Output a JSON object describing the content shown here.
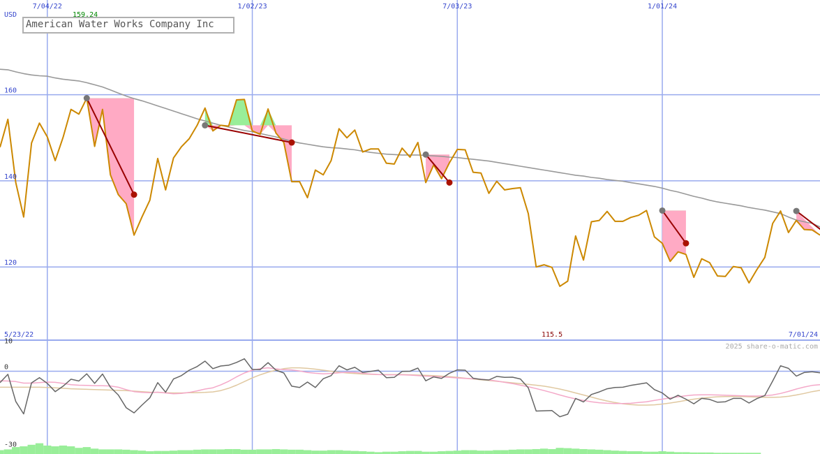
{
  "chart_data": {
    "type": "line",
    "title": "American Water Works Company Inc",
    "currency": "USD",
    "watermark": "2025 share-o-matic.com",
    "start_date_label": "5/23/22",
    "end_date_label": "7/01/24",
    "period_high_label": "159.24",
    "period_low_label": "115.5",
    "x_tick_labels": [
      "7/04/22",
      "1/02/23",
      "7/03/23",
      "1/01/24"
    ],
    "x_tick_weeks": [
      6,
      32,
      58,
      84
    ],
    "y_ticks": [
      120,
      140,
      160
    ],
    "ylim": [
      103,
      182
    ],
    "osc_ticks": [
      10,
      0,
      -30
    ],
    "osc_ylim": [
      -32,
      12
    ],
    "colors": {
      "price": "#cc8800",
      "ma": "#999999",
      "grid": "#99aaee",
      "axis_label": "#3344cc",
      "high_label": "#008800",
      "low_label": "#880000",
      "gain_fill": "#99ee99",
      "loss_fill": "#ffaac4",
      "trend_line": "#990000",
      "osc_line": "#666666",
      "osc_fast": "#f4a8c8",
      "osc_slow": "#e0c8a0",
      "volume": "#99ee99"
    },
    "series": [
      {
        "name": "price",
        "values": [
          147.8,
          154.3,
          139.6,
          131.6,
          148.8,
          153.4,
          150.2,
          144.7,
          150.1,
          156.6,
          155.5,
          159.2,
          148.0,
          156.6,
          141.4,
          136.8,
          134.7,
          127.4,
          131.6,
          135.5,
          145.2,
          137.9,
          145.3,
          147.9,
          149.8,
          152.9,
          156.9,
          151.6,
          152.9,
          152.7,
          158.8,
          158.9,
          151.6,
          150.8,
          156.7,
          151.1,
          148.9,
          139.8,
          139.8,
          136.1,
          142.5,
          141.4,
          144.7,
          152.1,
          150.0,
          151.8,
          146.7,
          147.4,
          147.4,
          144.1,
          143.9,
          147.6,
          145.5,
          148.9,
          139.6,
          143.7,
          140.5,
          144.2,
          147.3,
          147.2,
          142.0,
          141.8,
          137.1,
          139.9,
          137.9,
          138.2,
          138.4,
          132.4,
          120.0,
          120.5,
          119.9,
          115.5,
          116.7,
          127.2,
          121.6,
          130.5,
          130.8,
          132.9,
          130.6,
          130.6,
          131.5,
          132.0,
          133.1,
          127.0,
          125.5,
          121.3,
          123.5,
          122.9,
          117.6,
          121.9,
          121.0,
          117.9,
          117.8,
          120.1,
          119.8,
          116.3,
          119.4,
          122.2,
          130.1,
          133.0,
          128.0,
          130.8,
          128.7,
          128.6,
          127.4
        ],
        "x_start": 0
      },
      {
        "name": "ma",
        "values": [
          165.9,
          165.8,
          165.3,
          164.9,
          164.6,
          164.4,
          164.3,
          163.9,
          163.6,
          163.4,
          163.2,
          162.8,
          162.3,
          161.8,
          161.1,
          160.4,
          159.7,
          159.1,
          158.6,
          158.0,
          157.4,
          156.8,
          156.2,
          155.6,
          155.0,
          154.4,
          153.9,
          153.4,
          152.9,
          152.5,
          152.1,
          151.7,
          151.4,
          151.0,
          150.6,
          150.2,
          149.7,
          149.2,
          148.8,
          148.5,
          148.2,
          147.9,
          147.7,
          147.6,
          147.4,
          147.2,
          146.9,
          146.6,
          146.4,
          146.2,
          146.1,
          146.0,
          146.0,
          146.0,
          145.9,
          145.8,
          145.7,
          145.5,
          145.4,
          145.2,
          145.0,
          144.8,
          144.6,
          144.3,
          144.0,
          143.7,
          143.4,
          143.1,
          142.8,
          142.5,
          142.2,
          141.9,
          141.6,
          141.3,
          141.1,
          140.8,
          140.6,
          140.3,
          140.1,
          139.9,
          139.6,
          139.3,
          139.0,
          138.7,
          138.3,
          137.8,
          137.4,
          136.9,
          136.4,
          136.0,
          135.5,
          135.1,
          134.8,
          134.5,
          134.2,
          133.8,
          133.5,
          133.2,
          132.8,
          132.4,
          131.6,
          130.9,
          130.5,
          130.1,
          129.3
        ],
        "x_start": 0
      },
      {
        "name": "oscillator",
        "values": [
          -4.4,
          -1.2,
          -11.7,
          -16.5,
          -4.5,
          -2.5,
          -4.7,
          -7.9,
          -5.8,
          -3.1,
          -3.8,
          -1.0,
          -4.7,
          -1.1,
          -6.2,
          -9.2,
          -14.1,
          -16.1,
          -13.1,
          -10.3,
          -4.4,
          -8.1,
          -3.0,
          -1.7,
          0.4,
          1.8,
          3.9,
          1.0,
          2.0,
          2.3,
          3.4,
          4.8,
          0.7,
          0.6,
          3.3,
          0.4,
          -0.7,
          -5.8,
          -6.3,
          -4.2,
          -6.3,
          -2.9,
          -1.7,
          2.1,
          0.5,
          1.5,
          -0.5,
          -0.1,
          0.4,
          -2.5,
          -2.4,
          -0.1,
          0.0,
          1.2,
          -3.7,
          -2.2,
          -2.8,
          -0.8,
          0.5,
          0.4,
          -2.7,
          -3.2,
          -3.4,
          -2.0,
          -2.4,
          -2.3,
          -3.0,
          -6.4,
          -15.4,
          -15.3,
          -15.2,
          -17.6,
          -16.6,
          -10.5,
          -11.9,
          -9.0,
          -8.0,
          -6.8,
          -6.3,
          -6.2,
          -5.5,
          -5.0,
          -4.5,
          -7.1,
          -8.4,
          -10.8,
          -9.3,
          -10.8,
          -12.6,
          -10.5,
          -10.9,
          -12.0,
          -11.8,
          -10.5,
          -10.5,
          -12.3,
          -10.6,
          -9.4,
          -3.8,
          2.1,
          1.1,
          -1.9,
          -0.5,
          -0.2,
          -0.6
        ],
        "x_start": 0
      },
      {
        "name": "oscillator_fast",
        "values": [
          -3.7,
          -3.8,
          -4.0,
          -4.6,
          -4.6,
          -4.4,
          -4.2,
          -4.3,
          -4.7,
          -5.2,
          -5.4,
          -5.5,
          -5.6,
          -5.6,
          -5.7,
          -6.2,
          -7.1,
          -7.9,
          -8.2,
          -8.3,
          -8.1,
          -8.4,
          -8.7,
          -8.6,
          -8.2,
          -7.6,
          -6.9,
          -6.4,
          -5.3,
          -3.9,
          -2.2,
          -0.7,
          0.4,
          1.0,
          1.3,
          0.9,
          0.6,
          0.5,
          0.1,
          -0.5,
          -0.8,
          -1.0,
          -0.9,
          -0.6,
          -0.4,
          -0.5,
          -0.8,
          -1.1,
          -1.3,
          -1.4,
          -1.4,
          -1.4,
          -1.5,
          -1.7,
          -1.9,
          -2.0,
          -2.2,
          -2.4,
          -2.6,
          -2.8,
          -2.9,
          -3.1,
          -3.4,
          -3.8,
          -4.3,
          -4.8,
          -5.4,
          -6.0,
          -6.7,
          -7.5,
          -8.3,
          -9.2,
          -10.0,
          -10.7,
          -11.3,
          -11.8,
          -12.2,
          -12.4,
          -12.5,
          -12.5,
          -12.4,
          -12.1,
          -11.8,
          -11.3,
          -10.8,
          -10.3,
          -9.9,
          -9.5,
          -9.2,
          -9.1,
          -9.1,
          -9.2,
          -9.3,
          -9.4,
          -9.5,
          -9.6,
          -9.6,
          -9.5,
          -9.2,
          -8.6,
          -7.8,
          -6.9,
          -6.1,
          -5.5,
          -5.2
        ],
        "x_start": 0
      },
      {
        "name": "oscillator_slow",
        "values": [
          -6.2,
          -6.2,
          -6.2,
          -6.2,
          -6.2,
          -6.2,
          -6.3,
          -6.4,
          -6.6,
          -6.8,
          -6.9,
          -7.0,
          -7.1,
          -7.2,
          -7.3,
          -7.4,
          -7.5,
          -7.7,
          -7.9,
          -8.1,
          -8.2,
          -8.3,
          -8.4,
          -8.4,
          -8.3,
          -8.3,
          -8.2,
          -8.0,
          -7.5,
          -6.6,
          -5.4,
          -4.0,
          -2.6,
          -1.4,
          -0.4,
          0.4,
          1.0,
          1.3,
          1.3,
          1.1,
          0.8,
          0.4,
          0.0,
          -0.4,
          -0.7,
          -0.9,
          -1.1,
          -1.2,
          -1.3,
          -1.3,
          -1.3,
          -1.3,
          -1.4,
          -1.5,
          -1.6,
          -1.7,
          -1.9,
          -2.1,
          -2.4,
          -2.7,
          -3.0,
          -3.3,
          -3.6,
          -3.9,
          -4.2,
          -4.5,
          -4.8,
          -5.1,
          -5.4,
          -5.8,
          -6.3,
          -6.9,
          -7.6,
          -8.4,
          -9.2,
          -10.0,
          -10.8,
          -11.5,
          -12.1,
          -12.6,
          -12.9,
          -13.1,
          -13.1,
          -13.0,
          -12.7,
          -12.3,
          -11.8,
          -11.3,
          -10.8,
          -10.4,
          -10.1,
          -9.9,
          -9.8,
          -9.8,
          -9.8,
          -9.9,
          -10.0,
          -10.1,
          -10.1,
          -10.0,
          -9.7,
          -9.2,
          -8.6,
          -7.9,
          -7.4
        ],
        "x_start": 0
      },
      {
        "name": "volume",
        "values": [
          0.25,
          0.3,
          0.45,
          0.5,
          0.6,
          0.7,
          0.55,
          0.5,
          0.55,
          0.5,
          0.4,
          0.45,
          0.35,
          0.3,
          0.3,
          0.3,
          0.28,
          0.25,
          0.22,
          0.18,
          0.2,
          0.2,
          0.22,
          0.25,
          0.25,
          0.28,
          0.3,
          0.3,
          0.3,
          0.32,
          0.32,
          0.28,
          0.28,
          0.3,
          0.3,
          0.32,
          0.3,
          0.28,
          0.28,
          0.25,
          0.22,
          0.22,
          0.25,
          0.25,
          0.22,
          0.2,
          0.18,
          0.15,
          0.12,
          0.15,
          0.15,
          0.18,
          0.2,
          0.2,
          0.15,
          0.15,
          0.18,
          0.2,
          0.22,
          0.25,
          0.25,
          0.22,
          0.22,
          0.25,
          0.25,
          0.28,
          0.3,
          0.3,
          0.32,
          0.35,
          0.32,
          0.4,
          0.38,
          0.35,
          0.32,
          0.3,
          0.28,
          0.25,
          0.22,
          0.2,
          0.18,
          0.18,
          0.15,
          0.15,
          0.18,
          0.15,
          0.12,
          0.12,
          0.1,
          0.1,
          0.1,
          0.08,
          0.08,
          0.08,
          0.08,
          0.08,
          0.08
        ],
        "x_start": 0
      }
    ],
    "signals": [
      {
        "start": 11,
        "end": 17,
        "kind": "loss",
        "start_price": 159.2,
        "end_price": 136.8
      },
      {
        "start": 26,
        "end": 37,
        "kind": "mixed",
        "start_price": 152.9,
        "end_price": 148.9
      },
      {
        "start": 54,
        "end": 57,
        "kind": "mixed",
        "start_price": 146.1,
        "end_price": 139.6
      },
      {
        "start": 84,
        "end": 87,
        "kind": "loss",
        "start_price": 133.1,
        "end_price": 125.5
      },
      {
        "start": 101,
        "end": 105,
        "kind": "loss",
        "start_price": 133.0,
        "end_price": 127.4
      }
    ]
  }
}
